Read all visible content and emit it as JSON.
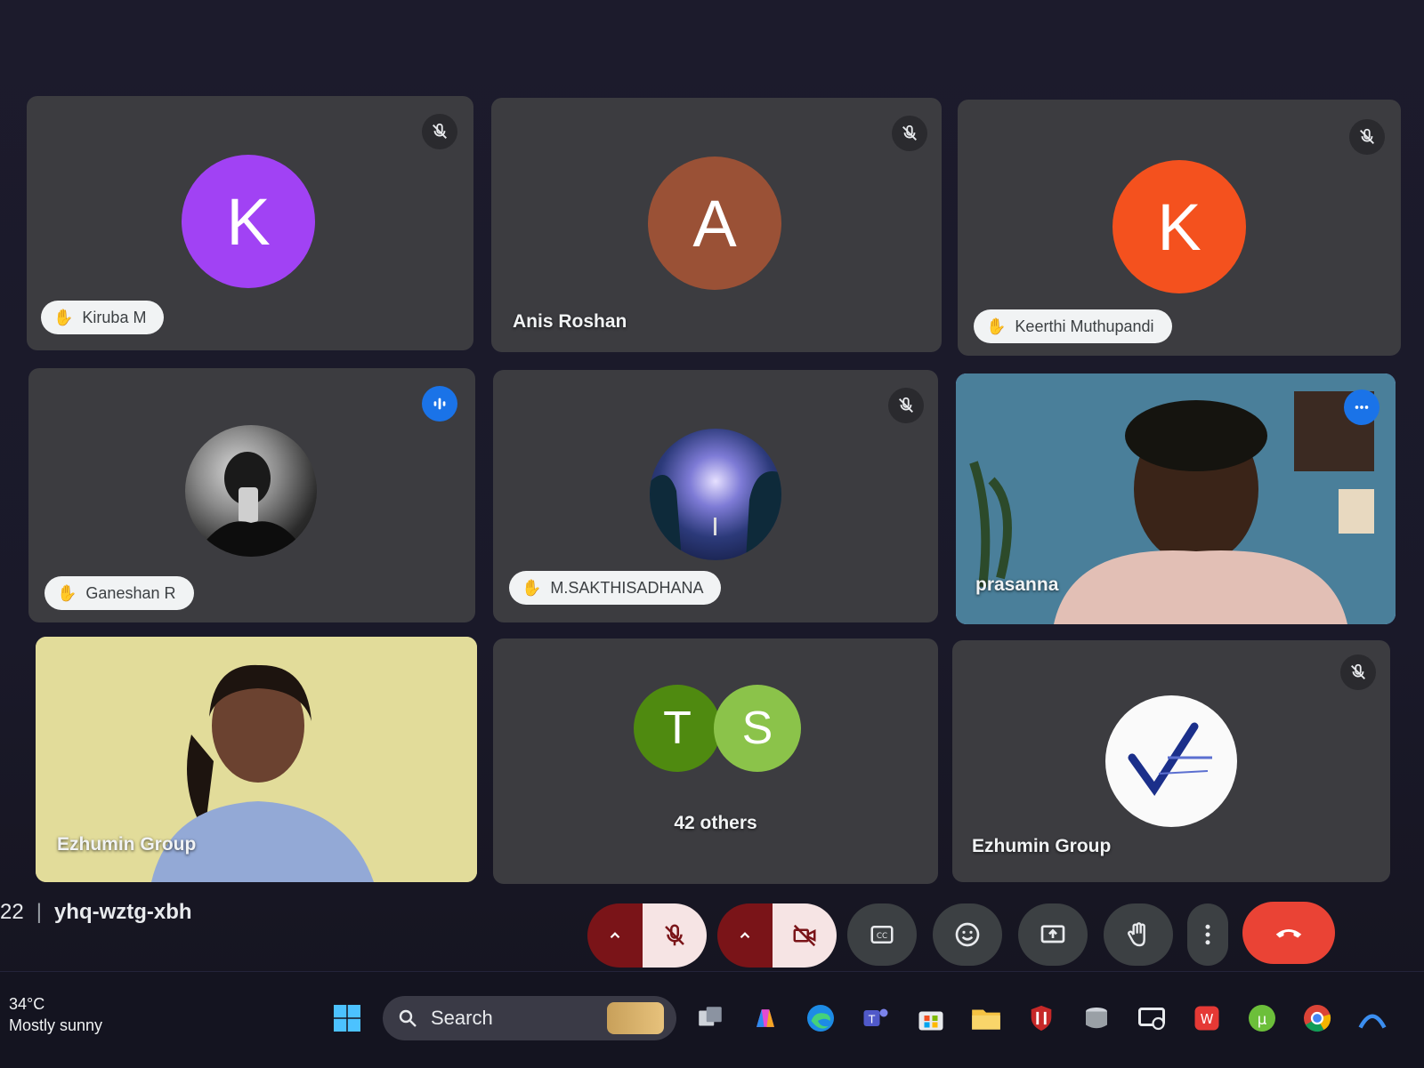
{
  "participants": [
    {
      "initial": "K",
      "name": "Kiruba M",
      "color": "#a142f4",
      "hand_raised": true,
      "muted": true
    },
    {
      "initial": "A",
      "name": "Anis Roshan",
      "color": "#9a5136",
      "hand_raised": false,
      "muted": true
    },
    {
      "initial": "K",
      "name": "Keerthi Muthupandi",
      "color": "#f4511e",
      "hand_raised": true,
      "muted": true
    },
    {
      "initial": "",
      "name": "Ganeshan R",
      "hand_raised": true,
      "speaking": true
    },
    {
      "initial": "",
      "name": "M.SAKTHISADHANA",
      "hand_raised": true,
      "muted": true
    },
    {
      "initial": "",
      "name": "prasanna",
      "video": true,
      "active": true
    },
    {
      "initial": "",
      "name": "Ezhumin Group",
      "video": true
    },
    {
      "initials": [
        "T",
        "S"
      ],
      "label": "42 others",
      "colors": [
        "#4f8a10",
        "#8bc34a"
      ]
    },
    {
      "initial": "",
      "name": "Ezhumin Group",
      "logo": true,
      "muted": true
    }
  ],
  "meeting": {
    "time_fragment": "22",
    "code": "yhq-wztg-xbh"
  },
  "controls": [
    "mic-muted",
    "camera-off",
    "captions",
    "reactions",
    "present",
    "raise-hand",
    "more-options",
    "leave-call"
  ],
  "accent": "#8ab4f8",
  "hangup_color": "#ea4335",
  "taskbar": {
    "weather_temp": "34°C",
    "weather_desc": "Mostly sunny",
    "search_label": "Search"
  }
}
